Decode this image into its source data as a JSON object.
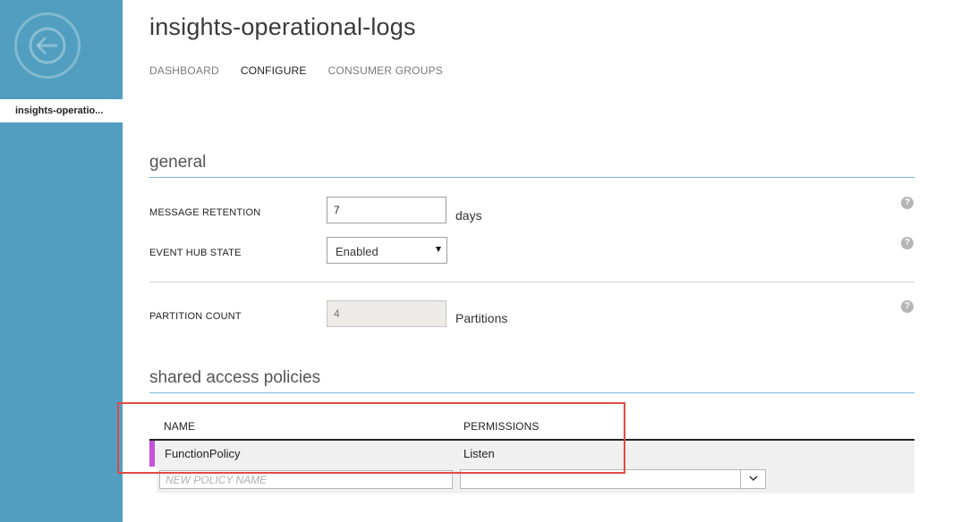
{
  "sidebar": {
    "back_icon": "arrow-left-circle-icon",
    "item_label": "insights-operatio..."
  },
  "header": {
    "title": "insights-operational-logs",
    "tabs": [
      {
        "label": "DASHBOARD",
        "active": false
      },
      {
        "label": "CONFIGURE",
        "active": true
      },
      {
        "label": "CONSUMER GROUPS",
        "active": false
      }
    ]
  },
  "general": {
    "title": "general",
    "message_retention": {
      "label": "MESSAGE RETENTION",
      "value": "7",
      "unit": "days"
    },
    "event_hub_state": {
      "label": "EVENT HUB STATE",
      "selected": "Enabled"
    },
    "partition_count": {
      "label": "PARTITION COUNT",
      "value": "4",
      "unit": "Partitions"
    },
    "help_glyph": "?"
  },
  "policies": {
    "title": "shared access policies",
    "columns": [
      "NAME",
      "PERMISSIONS"
    ],
    "rows": [
      {
        "name": "FunctionPolicy",
        "permissions": "Listen",
        "marker_color": "#c452d8"
      }
    ],
    "new_policy_placeholder": "NEW POLICY NAME",
    "new_permissions_value": ""
  },
  "colors": {
    "sidebar": "#519ec0",
    "accent_line": "#7cb5dd",
    "highlight": "#e04a45"
  }
}
